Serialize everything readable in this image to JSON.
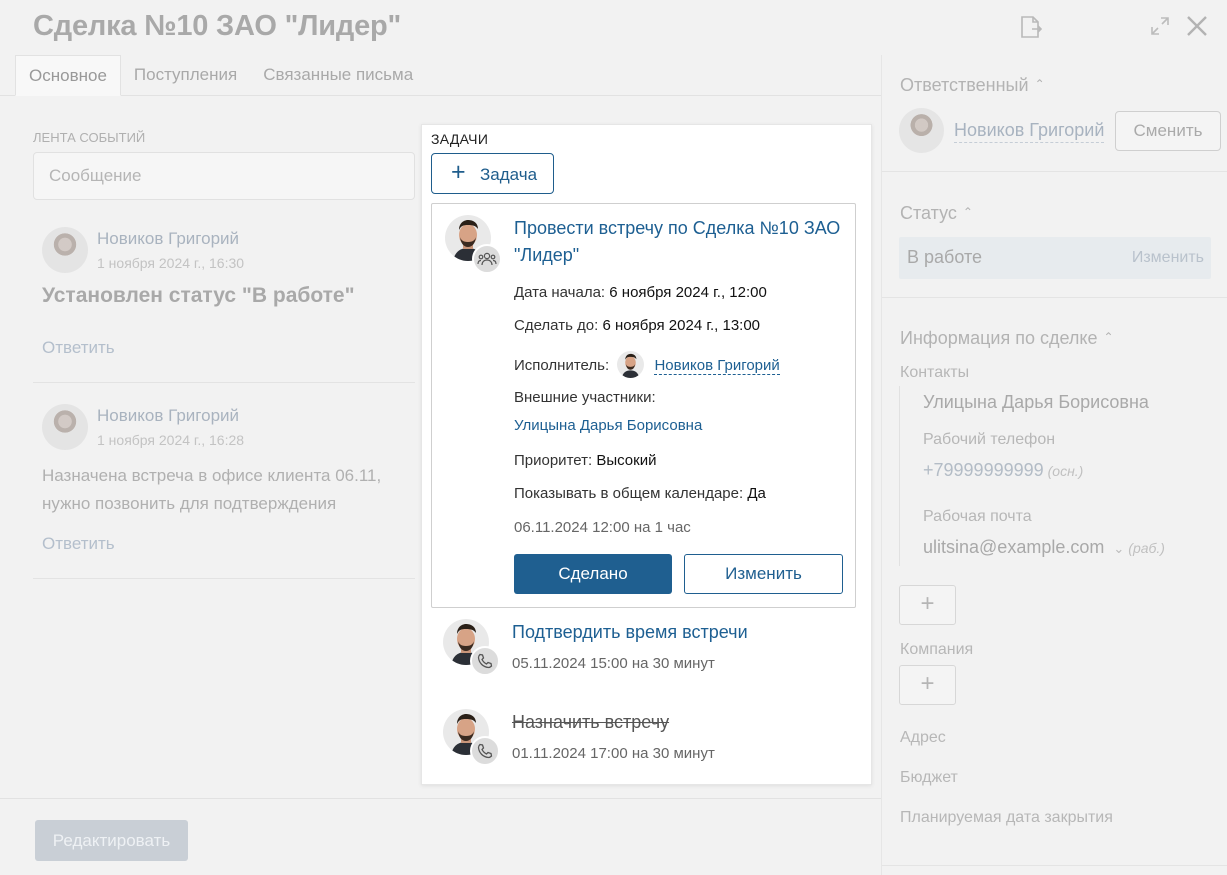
{
  "deal": {
    "title": "Сделка №10 ЗАО \"Лидер\"",
    "tabs": [
      {
        "label": "Основное",
        "active": true
      },
      {
        "label": "Поступления",
        "active": false
      },
      {
        "label": "Связанные письма",
        "active": false
      }
    ]
  },
  "feed": {
    "caption": "ЛЕНТА СОБЫТИЙ",
    "message_placeholder": "Сообщение",
    "items": [
      {
        "author": "Новиков Григорий",
        "date": "1 ноября 2024 г., 16:30",
        "text": "Установлен статус \"В работе\"",
        "reply": "Ответить"
      },
      {
        "author": "Новиков Григорий",
        "date": "1 ноября 2024 г., 16:28",
        "text": "Назначена встреча в офисе клиента 06.11, нужно позвонить для подтверждения",
        "reply": "Ответить"
      }
    ]
  },
  "footer": {
    "edit_label": "Редактировать"
  },
  "right_panel": {
    "responsible_title": "Ответственный",
    "responsible_name": "Новиков Григорий",
    "change_label": "Сменить",
    "status_title": "Статус",
    "status_value": "В работе",
    "status_change": "Изменить",
    "info_title": "Информация по сделке",
    "contacts_label": "Контакты",
    "contact_name": "Улицына Дарья Борисовна",
    "work_phone_label": "Рабочий телефон",
    "work_phone": "+79999999999",
    "work_phone_tag": "(осн.)",
    "work_email_label": "Рабочая почта",
    "work_email": "ulitsina@example.com",
    "work_email_tag": "(раб.)",
    "company_label": "Компания",
    "address_label": "Адрес",
    "budget_label": "Бюджет",
    "close_date_label": "Планируемая дата закрытия",
    "plus_glyph": "+"
  },
  "tasks": {
    "caption": "ЗАДАЧИ",
    "add_label": "Задача",
    "plus_glyph": "+",
    "expanded": {
      "title": "Провести встречу по Сделка №10 ЗАО \"Лидер\"",
      "start_label": "Дата начала:",
      "start_value": "6 ноября 2024 г., 12:00",
      "due_label": "Сделать до:",
      "due_value": "6 ноября 2024 г., 13:00",
      "assignee_label": "Исполнитель:",
      "assignee_name": "Новиков Григорий",
      "external_label": "Внешние участники:",
      "external_name": "Улицына Дарья Борисовна",
      "priority_label": "Приоритет:",
      "priority_value": "Высокий",
      "calendar_label": "Показывать в общем календаре:",
      "calendar_value": "Да",
      "when": "06.11.2024 12:00 на 1 час",
      "done_label": "Сделано",
      "edit_label": "Изменить"
    },
    "items": [
      {
        "title": "Подтвердить время встречи",
        "when": "05.11.2024 15:00 на 30 минут",
        "completed": false,
        "icon": "phone-icon"
      },
      {
        "title": "Назначить встречу",
        "when": "01.11.2024 17:00 на 30 минут",
        "completed": true,
        "icon": "phone-icon"
      }
    ]
  },
  "colors": {
    "accent": "#1f5f90",
    "link": "#1d5f92"
  }
}
